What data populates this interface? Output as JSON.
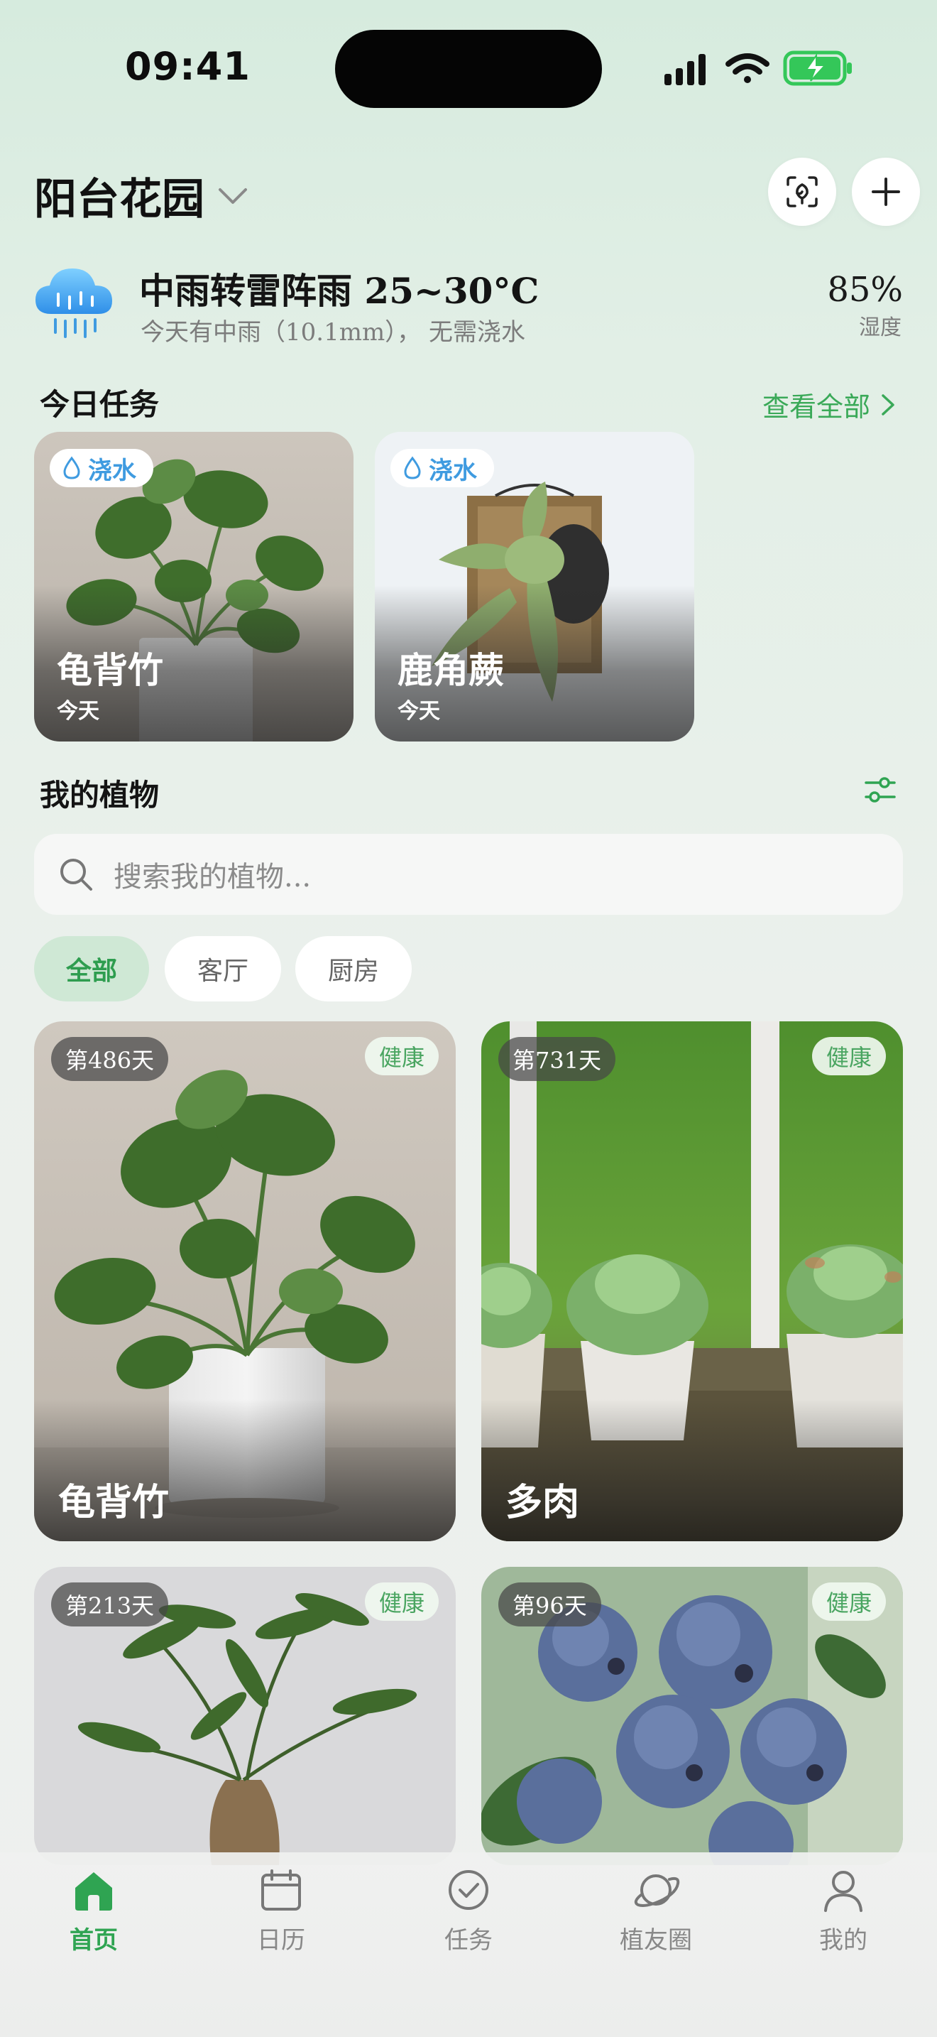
{
  "status_bar": {
    "time": "09:41"
  },
  "header": {
    "garden_name": "阳台花园"
  },
  "weather": {
    "summary": "中雨转雷阵雨 25~30°C",
    "detail": "今天有中雨（10.1mm），  无需浇水",
    "humidity_value": "85%",
    "humidity_label": "湿度"
  },
  "today_tasks": {
    "title": "今日任务",
    "view_all": "查看全部",
    "items": [
      {
        "tag": "浇水",
        "name": "龟背竹",
        "date": "今天"
      },
      {
        "tag": "浇水",
        "name": "鹿角蕨",
        "date": "今天"
      }
    ]
  },
  "my_plants": {
    "title": "我的植物",
    "search_placeholder": "搜索我的植物...",
    "filters": [
      {
        "label": "全部",
        "active": true
      },
      {
        "label": "客厅",
        "active": false
      },
      {
        "label": "厨房",
        "active": false
      }
    ],
    "items": [
      {
        "days": "第486天",
        "status": "健康",
        "name": "龟背竹"
      },
      {
        "days": "第731天",
        "status": "健康",
        "name": "多肉"
      },
      {
        "days": "第213天",
        "status": "健康",
        "name": ""
      },
      {
        "days": "第96天",
        "status": "健康",
        "name": ""
      }
    ]
  },
  "tabbar": {
    "items": [
      {
        "label": "首页",
        "icon": "home-icon",
        "active": true
      },
      {
        "label": "日历",
        "icon": "calendar-icon",
        "active": false
      },
      {
        "label": "任务",
        "icon": "check-circle-icon",
        "active": false
      },
      {
        "label": "植友圈",
        "icon": "planet-icon",
        "active": false
      },
      {
        "label": "我的",
        "icon": "user-icon",
        "active": false
      }
    ]
  },
  "colors": {
    "accent": "#2fa452",
    "water": "#3f9be0",
    "health": "#4aa561"
  }
}
